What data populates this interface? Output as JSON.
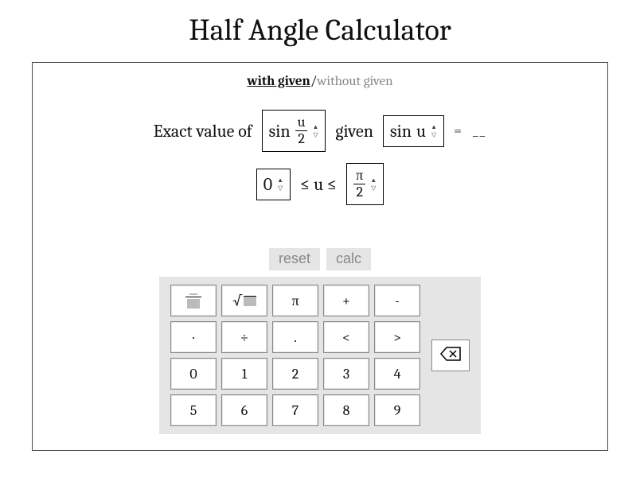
{
  "title": "Half Angle Calculator",
  "tabs": {
    "active": "with given",
    "inactive": "without given"
  },
  "row1": {
    "prefix": "Exact value of",
    "select1_fn": "sin",
    "select1_arg_num": "u",
    "select1_arg_den": "2",
    "given_word": "given",
    "select2_fn": "sin",
    "select2_arg": "u",
    "equals": "=",
    "blank": "__"
  },
  "row2": {
    "low": "0",
    "between": "≤ u ≤",
    "high_num": "π",
    "high_den": "2"
  },
  "actions": {
    "reset": "reset",
    "calc": "calc"
  },
  "keypad": {
    "rows": [
      [
        "frac",
        "sqrt",
        "π",
        "+",
        "-"
      ],
      [
        "·",
        "÷",
        ".",
        "<",
        ">"
      ],
      [
        "0",
        "1",
        "2",
        "3",
        "4"
      ],
      [
        "5",
        "6",
        "7",
        "8",
        "9"
      ]
    ]
  }
}
